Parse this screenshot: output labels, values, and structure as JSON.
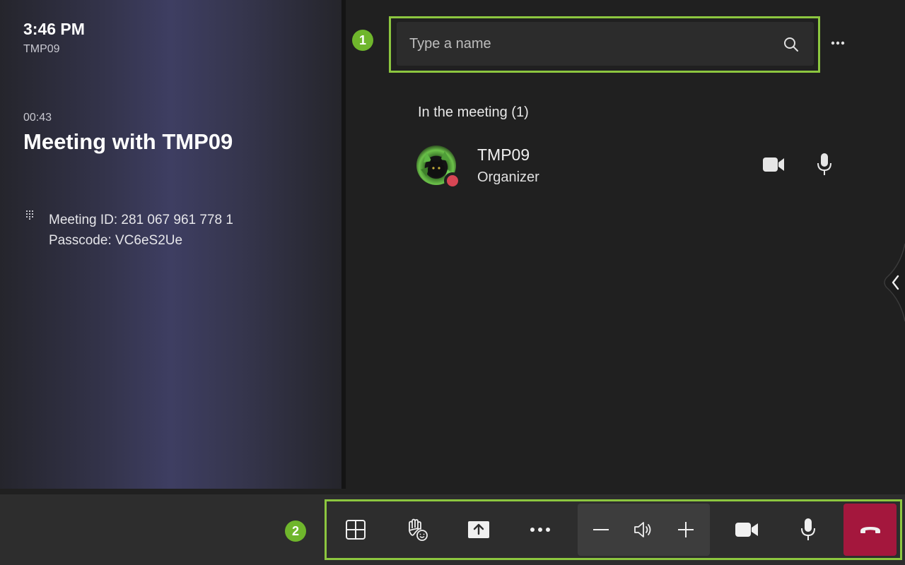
{
  "meeting_info": {
    "clock": "3:46 PM",
    "device_name": "TMP09",
    "duration": "00:43",
    "title": "Meeting with TMP09",
    "meeting_id": "Meeting ID:  281 067 961 778 1",
    "passcode": "Passcode: VC6eS2Ue"
  },
  "annotations": {
    "badge_1": "1",
    "badge_2": "2"
  },
  "search": {
    "placeholder": "Type a name"
  },
  "participants": {
    "header": "In the meeting (1)",
    "items": [
      {
        "name": "TMP09",
        "role": "Organizer",
        "status": "busy"
      }
    ]
  },
  "icons": {
    "search": "search-icon",
    "more_options": "more-horizontal-icon",
    "dialpad": "dialpad-icon",
    "participant_video": "video-camera-icon",
    "participant_mic": "microphone-icon",
    "side_panel_toggle": "chevron-left-icon",
    "layout": "grid-layout-icon",
    "reactions": "raise-hand-reaction-icon",
    "share": "share-screen-icon",
    "more_actions": "ellipsis-icon",
    "volume_down": "minus-icon",
    "speaker": "speaker-icon",
    "volume_up": "plus-icon",
    "camera": "video-camera-icon",
    "mic": "microphone-icon",
    "hang_up": "hang-up-icon"
  },
  "colors": {
    "accent_highlight": "#8cc63f",
    "badge": "#6fb62c",
    "hangup": "#a4173d",
    "presence_busy": "#d74654"
  }
}
